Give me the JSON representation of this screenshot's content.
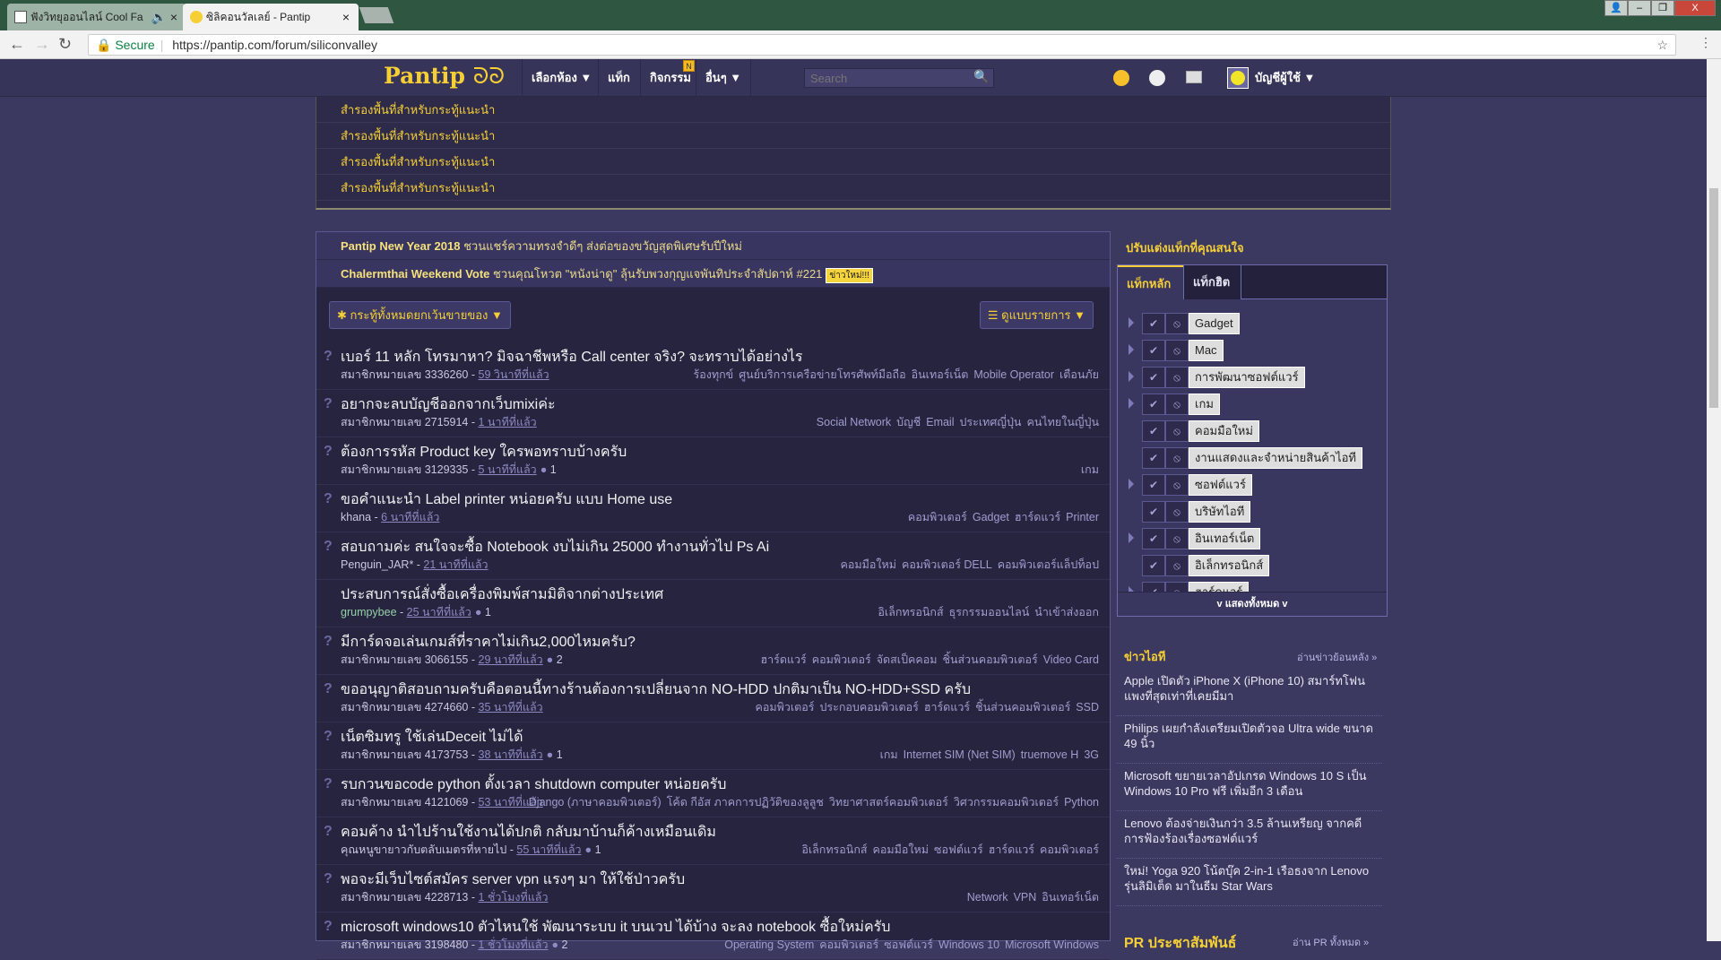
{
  "browser": {
    "tabs": [
      {
        "title": "ฟังวิทยุออนไลน์ Cool Fa"
      },
      {
        "title": "ซิลิคอนวัลเลย์ - Pantip"
      }
    ],
    "secure_label": "Secure",
    "url": "https://pantip.com/forum/siliconvalley"
  },
  "header": {
    "logo": "Pantip",
    "nav": [
      "เลือกห้อง ▼",
      "แท็ก",
      "กิจกรรม",
      "อื่นๆ ▼"
    ],
    "nav_badge": "N",
    "search_placeholder": "Search",
    "account": "บัญชีผู้ใช้ ▼"
  },
  "reserved": [
    "สำรองพื้นที่สำหรับกระทู้แนะนำ",
    "สำรองพื้นที่สำหรับกระทู้แนะนำ",
    "สำรองพื้นที่สำหรับกระทู้แนะนำ",
    "สำรองพื้นที่สำหรับกระทู้แนะนำ"
  ],
  "announcements": [
    {
      "bold": "Pantip New Year 2018",
      "text": " ชวนแชร์ความทรงจำดีๆ ส่งต่อของขวัญสุดพิเศษรับปีใหม่"
    },
    {
      "bold": "Chalermthai Weekend Vote",
      "text": " ชวนคุณโหวต \"หนังน่าดู\" ลุ้นรับพวงกุญแจพันทิประจำสัปดาห์ #221",
      "badge": "ข่าวใหม่!!!"
    }
  ],
  "filter": {
    "left": "กระทู้ทั้งหมดยกเว้นขายของ ▼",
    "right": "ดูแบบรายการ ▼"
  },
  "topics": [
    {
      "q": "?",
      "title": "เบอร์ 11 หลัก โทรมาหา? มิจฉาชีพหรือ Call center จริง? จะทราบได้อย่างไร",
      "author": "สมาชิกหมายเลข 3336260",
      "time": "59 วินาทีที่แล้ว",
      "comments": "",
      "tags": [
        "ร้องทุกข์",
        "ศูนย์บริการเครือข่ายโทรศัพท์มือถือ",
        "อินเทอร์เน็ต",
        "Mobile Operator",
        "เตือนภัย"
      ]
    },
    {
      "q": "?",
      "title": "อยากจะลบบัญชีออกจากเว็บmixiค่ะ",
      "author": "สมาชิกหมายเลข 2715914",
      "time": "1 นาทีที่แล้ว",
      "comments": "",
      "tags": [
        "Social Network",
        "บัญชี",
        "Email",
        "ประเทศญี่ปุ่น",
        "คนไทยในญี่ปุ่น"
      ]
    },
    {
      "q": "?",
      "title": "ต้องการรหัส Product key ใครพอทราบบ้างครับ",
      "author": "สมาชิกหมายเลข 3129335",
      "time": "5 นาทีที่แล้ว",
      "comments": "1",
      "tags": [
        "เกม"
      ]
    },
    {
      "q": "?",
      "title": "ขอคำแนะนำ Label printer หน่อยครับ แบบ Home use",
      "author": "khana",
      "time": "6 นาทีที่แล้ว",
      "comments": "",
      "tags": [
        "คอมพิวเตอร์",
        "Gadget",
        "ฮาร์ดแวร์",
        "Printer"
      ]
    },
    {
      "q": "?",
      "title": "สอบถามค่ะ สนใจจะซื้อ Notebook งบไม่เกิน 25000 ทำงานทั่วไป Ps Ai",
      "author": "Penguin_JAR*",
      "time": "21 นาทีที่แล้ว",
      "comments": "",
      "tags": [
        "คอมมือใหม่",
        "คอมพิวเตอร์ DELL",
        "คอมพิวเตอร์แล็ปท็อป"
      ]
    },
    {
      "q": "",
      "title": "ประสบการณ์สั่งซื้อเครื่องพิมพ์สามมิติจากต่างประเทศ",
      "author": "grumpybee",
      "author_highlight": true,
      "time": "25 นาทีที่แล้ว",
      "comments": "1",
      "tags": [
        "อิเล็กทรอนิกส์",
        "ธุรกรรมออนไลน์",
        "นำเข้าส่งออก"
      ]
    },
    {
      "q": "?",
      "title": "มีการ์ดจอเล่นเกมส์ที่ราคาไม่เกิน2,000ไหมครับ?",
      "author": "สมาชิกหมายเลข 3066155",
      "time": "29 นาทีที่แล้ว",
      "comments": "2",
      "tags": [
        "ฮาร์ดแวร์",
        "คอมพิวเตอร์",
        "จัดสเป็คคอม",
        "ชิ้นส่วนคอมพิวเตอร์",
        "Video Card"
      ]
    },
    {
      "q": "?",
      "title": "ขออนุญาติสอบถามครับคือตอนนี้ทางร้านต้องการเปลี่ยนจาก NO-HDD ปกติมาเป็น NO-HDD+SSD ครับ",
      "author": "สมาชิกหมายเลข 4274660",
      "time": "35 นาทีที่แล้ว",
      "comments": "",
      "tags": [
        "คอมพิวเตอร์",
        "ประกอบคอมพิวเตอร์",
        "ฮาร์ดแวร์",
        "ชิ้นส่วนคอมพิวเตอร์",
        "SSD"
      ]
    },
    {
      "q": "?",
      "title": "เน็ตซิมทรู ใช้เล่นDeceit ไม่ได้",
      "author": "สมาชิกหมายเลข 4173753",
      "time": "38 นาทีที่แล้ว",
      "comments": "1",
      "tags": [
        "เกม",
        "Internet SIM (Net SIM)",
        "truemove H",
        "3G"
      ]
    },
    {
      "q": "?",
      "title": "รบกวนขอcode python ตั้งเวลา shutdown computer หน่อยครับ",
      "author": "สมาชิกหมายเลข 4121069",
      "time": "53 นาทีที่แล้ว",
      "comments": "",
      "tags": [
        "Django (ภาษาคอมพิวเตอร์)",
        "โค้ด กีอัส ภาคการปฏิวัติของลูลูช",
        "วิทยาศาสตร์คอมพิวเตอร์",
        "วิศวกรรมคอมพิวเตอร์",
        "Python"
      ]
    },
    {
      "q": "?",
      "title": "คอมค้าง นำไปร้านใช้งานได้ปกติ กลับมาบ้านก็ค้างเหมือนเดิม",
      "author": "คุณหนูขายาวกับตลับเมตรที่หายไป",
      "time": "55 นาทีที่แล้ว",
      "comments": "1",
      "tags": [
        "อิเล็กทรอนิกส์",
        "คอมมือใหม่",
        "ซอฟต์แวร์",
        "ฮาร์ดแวร์",
        "คอมพิวเตอร์"
      ]
    },
    {
      "q": "?",
      "title": "พอจะมีเว็บไซต์สมัคร server vpn แรงๆ มา ให้ใช้ป่าวครับ",
      "author": "สมาชิกหมายเลข 4228713",
      "time": "1 ชั่วโมงที่แล้ว",
      "comments": "",
      "tags": [
        "Network",
        "VPN",
        "อินเทอร์เน็ต"
      ]
    },
    {
      "q": "?",
      "title": "microsoft windows10 ตัวไหนใช้ พัฒนาระบบ it บนเวป ได้บ้าง จะลง notebook ซื้อใหม่ครับ",
      "author": "สมาชิกหมายเลข 3198480",
      "time": "1 ชั่วโมงที่แล้ว",
      "comments": "2",
      "tags": [
        "Operating System",
        "คอมพิวเตอร์",
        "ซอฟต์แวร์",
        "Windows 10",
        "Microsoft Windows"
      ]
    }
  ],
  "sidebar": {
    "title": "ปรับแต่งแท็กที่คุณสนใจ",
    "tabs": [
      "แท็กหลัก",
      "แท็กฮิต"
    ],
    "tags": [
      {
        "name": "Gadget",
        "expand": true
      },
      {
        "name": "Mac",
        "expand": true
      },
      {
        "name": "การพัฒนาซอฟต์แวร์",
        "expand": true
      },
      {
        "name": "เกม",
        "expand": true
      },
      {
        "name": "คอมมือใหม่",
        "expand": false
      },
      {
        "name": "งานแสดงและจำหน่ายสินค้าไอที",
        "expand": false
      },
      {
        "name": "ซอฟต์แวร์",
        "expand": true
      },
      {
        "name": "บริษัทไอที",
        "expand": false
      },
      {
        "name": "อินเทอร์เน็ต",
        "expand": true
      },
      {
        "name": "อิเล็กทรอนิกส์",
        "expand": false
      },
      {
        "name": "ฮาร์ดแวร์",
        "expand": true
      }
    ],
    "show_all": "v แสดงทั้งหมด v",
    "news_title": "ข่าวไอที",
    "news_more": "อ่านข่าวย้อนหลัง »",
    "news": [
      "Apple เปิดตัว iPhone X (iPhone 10) สมาร์ทโฟนแพงที่สุดเท่าที่เคยมีมา",
      "Philips เผยกำลังเตรียมเปิดตัวจอ Ultra wide ขนาด 49 นิ้ว",
      "Microsoft ขยายเวลาอัปเกรด Windows 10 S เป็น Windows 10 Pro ฟรี เพิ่มอีก 3 เดือน",
      "Lenovo ต้องจ่ายเงินกว่า 3.5 ล้านเหรียญ จากคดีการฟ้องร้องเรื่องซอฟต์แวร์",
      "ใหม่! Yoga 920 โน้ตบุ๊ค 2-in-1 เรือธงจาก Lenovo รุ่นลิมิเต็ด มาในธีม Star Wars"
    ],
    "pr_title": "PR ประชาสัมพันธ์",
    "pr_more": "อ่าน PR ทั้งหมด »"
  },
  "colors": {
    "accent": "#f5cf35",
    "bg": "#3b3960",
    "list_bg": "#272440"
  }
}
